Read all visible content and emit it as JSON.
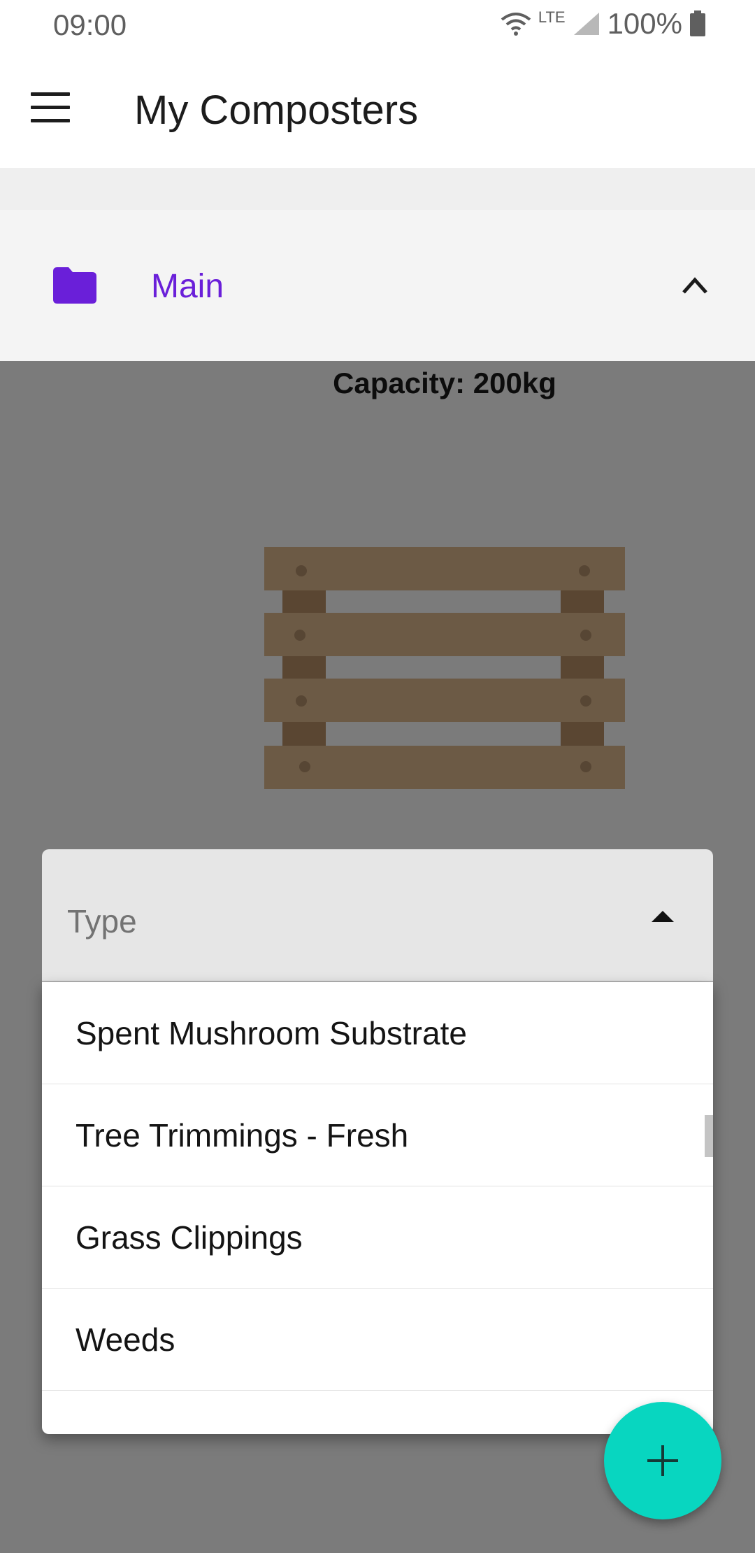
{
  "status_bar": {
    "time": "09:00",
    "network": "LTE",
    "battery": "100%"
  },
  "app_bar": {
    "title": "My Composters",
    "menu_icon": "menu-icon"
  },
  "group": {
    "label": "Main",
    "icon": "folder-icon",
    "expand_icon": "chevron-up-icon",
    "accent_color": "#6a1fd9"
  },
  "composter": {
    "capacity": "Capacity: 200kg",
    "image": "wooden-pallet"
  },
  "type_select": {
    "label": "Type",
    "options": [
      "Spent Mushroom Substrate",
      "Tree Trimmings - Fresh",
      "Grass Clippings",
      "Weeds"
    ]
  },
  "fab": {
    "icon": "plus-icon",
    "color": "#08d6c0"
  }
}
